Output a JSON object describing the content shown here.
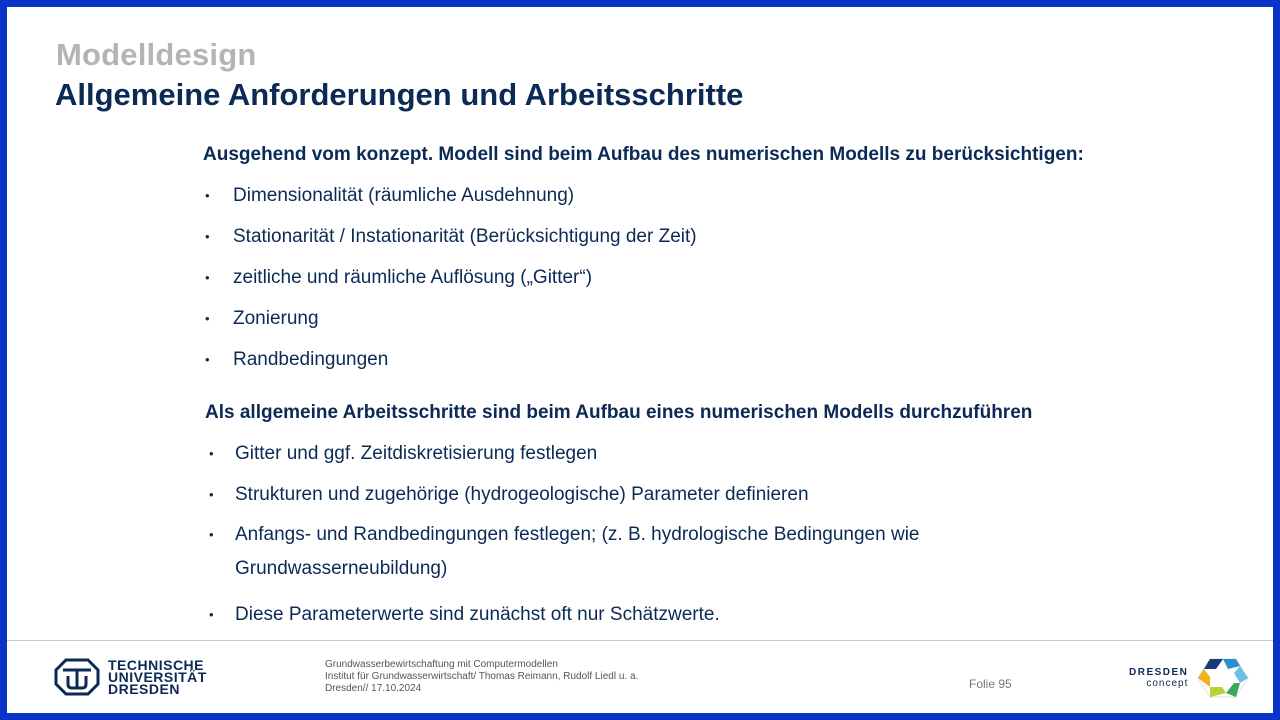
{
  "slide": {
    "kicker": "Modelldesign",
    "title": "Allgemeine Anforderungen und Arbeitsschritte"
  },
  "section1": {
    "heading": "Ausgehend vom konzept. Modell sind beim Aufbau des numerischen Modells zu berücksichtigen:",
    "items": [
      "Dimensionalität (räumliche Ausdehnung)",
      "Stationarität / Instationarität (Berücksichtigung der Zeit)",
      "zeitliche und räumliche Auflösung („Gitter“)",
      "Zonierung",
      "Randbedingungen"
    ]
  },
  "section2": {
    "heading": "Als allgemeine Arbeitsschritte sind beim Aufbau eines numerischen Modells durchzuführen",
    "items": [
      "Gitter und ggf. Zeitdiskretisierung festlegen",
      "Strukturen und zugehörige (hydrogeologische) Parameter definieren",
      "Anfangs- und Randbedingungen festlegen; (z. B. hydrologische Bedingungen wie Grundwasserneubildung)",
      "Diese Parameterwerte sind zunächst oft nur Schätzwerte."
    ]
  },
  "footer": {
    "university_line1": "TECHNISCHE",
    "university_line2": "UNIVERSITÄT",
    "university_line3": "DRESDEN",
    "info_line1": "Grundwasserbewirtschaftung mit Computermodellen",
    "info_line2": "Institut für Grundwasserwirtschaft/ Thomas Reimann, Rudolf Liedl u. a.",
    "info_line3": "Dresden// 17.10.2024",
    "slide_number": "Folie 95",
    "dd_line1": "DRESDEN",
    "dd_line2": "concept"
  },
  "colors": {
    "border": "#0a33c8",
    "title": "#0b2a55",
    "kicker": "#b4b4b4"
  },
  "icons": {
    "tud_logo": "tu-dresden-logo-icon",
    "dresden_concept_logo": "dresden-concept-logo-icon",
    "bullet": "bullet-dot"
  }
}
